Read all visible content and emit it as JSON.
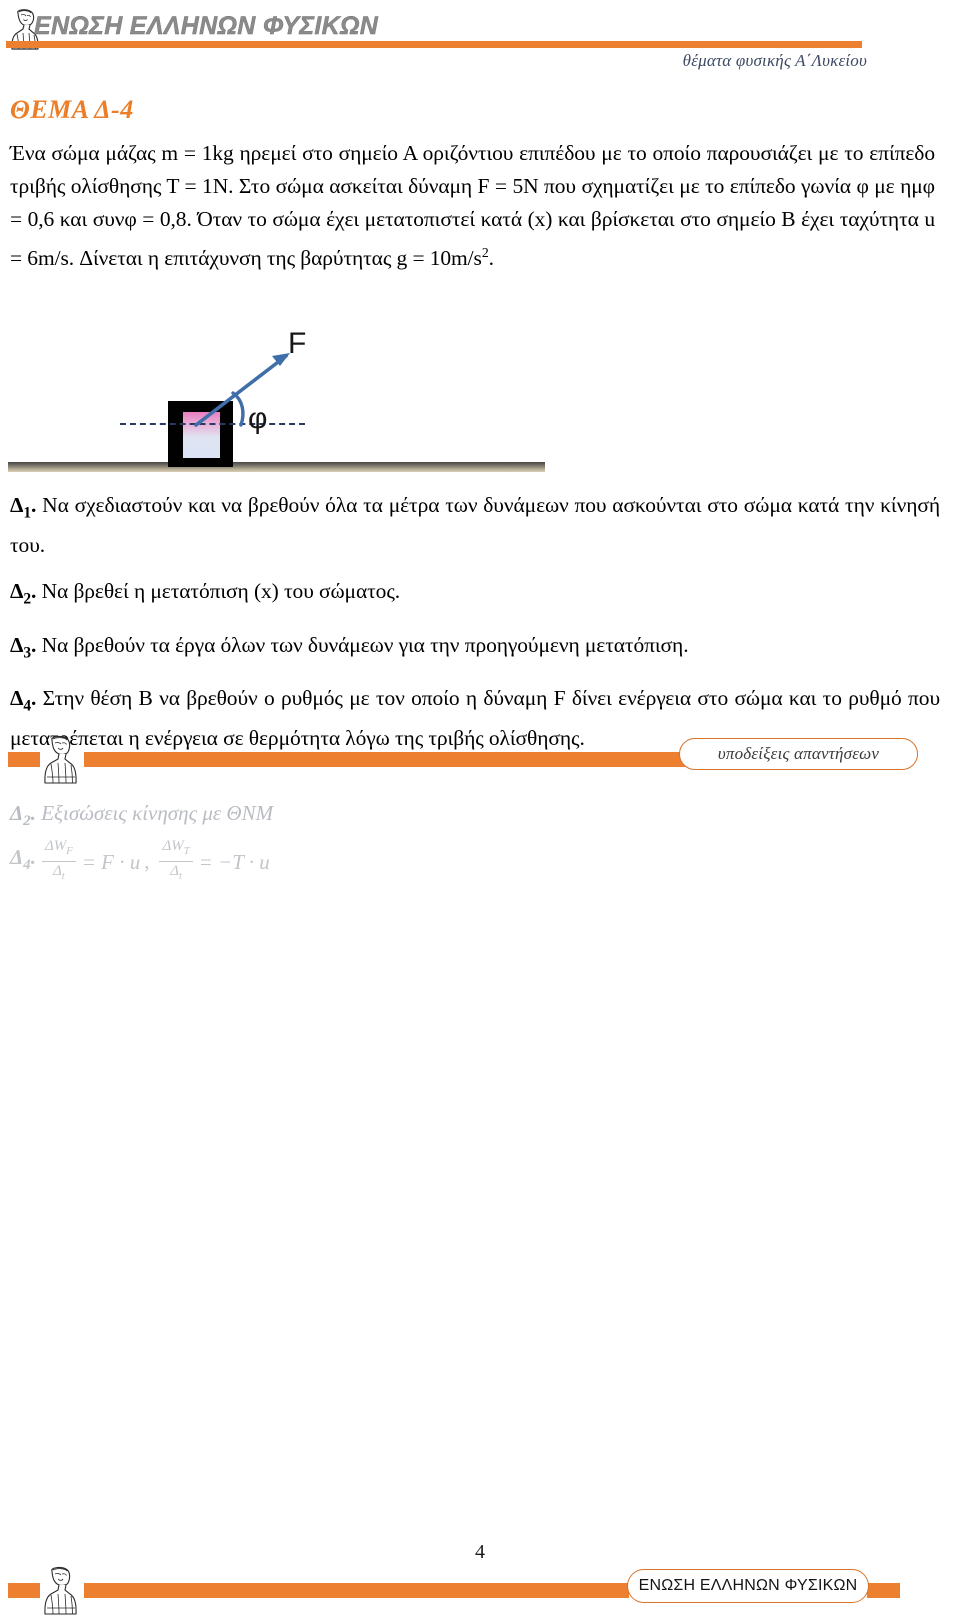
{
  "header": {
    "logo_text": "ΕΝΩΣΗ ΕΛΛΗΝΩΝ ΦΥΣΙΚΩΝ",
    "subtitle": "θέματα φυσικής Α΄Λυκείου",
    "rule_color": "#ed8030"
  },
  "title": "ΘΕΜΑ Δ-4",
  "title_color": "#ed7d26",
  "intro": {
    "part1": "Ένα σώμα μάζας m = 1kg ηρεμεί στο σημείο Α οριζόντιου επιπέδου με το οποίο παρουσιάζει με το επίπεδο τριβής ολίσθησης Τ = 1Ν. Στο σώμα ασκείται δύναμη F = 5Ν που σχηματίζει με το επίπεδο γωνία φ με ημφ = 0,6 και συνφ = 0,8. Όταν το σώμα έχει μετατοπιστεί κατά (x) και βρίσκεται στο σημείο Β έχει ταχύτητα u = 6m/s. Δίνεται η επιτάχυνση της βαρύτητας g = 10m/s",
    "exponent": "2",
    "part2": "."
  },
  "diagram": {
    "force_label": "F",
    "angle_label": "φ",
    "arrow_color": "#3f6ea8",
    "box_color": "#010101",
    "dashed_color": "#2b3a60",
    "ground_colors": [
      "#4a4742",
      "#d8cfb6"
    ]
  },
  "questions": [
    {
      "label": "Δ",
      "index": "1",
      "text": "Να σχεδιαστούν και να βρεθούν όλα τα μέτρα των δυνάμεων που ασκούνται στο σώμα κατά την κίνησή του."
    },
    {
      "label": "Δ",
      "index": "2",
      "text": "Να βρεθεί η μετατόπιση (x) του σώματος."
    },
    {
      "label": "Δ",
      "index": "3",
      "text": "Να βρεθούν τα έργα όλων των δυνάμεων για την προηγούμενη μετατόπιση."
    },
    {
      "label": "Δ",
      "index": "4",
      "text": "Στην θέση Β να βρεθούν ο ρυθμός με τον οποίο η δύναμη F δίνει ενέργεια στο σώμα και το ρυθμό που μετατρέπεται η ενέργεια σε θερμότητα λόγω της τριβής ολίσθησης."
    }
  ],
  "hints": {
    "pill_label": "υποδείξεις απαντήσεων",
    "answer_text_line": {
      "label": "Δ",
      "index": "2",
      "text": "Εξισώσεις κίνησης με ΘΝΜ"
    },
    "answer_formula_line": {
      "label": "Δ",
      "index": "4",
      "frac1_num": "ΔW",
      "frac1_num_sub": "F",
      "frac1_den": "Δ",
      "frac1_den_sub": "t",
      "eq1": "= F · u",
      "separator": ",",
      "frac2_num": "ΔW",
      "frac2_num_sub": "T",
      "frac2_den": "Δ",
      "frac2_den_sub": "t",
      "eq2": "= −T · u"
    }
  },
  "page_number": "4",
  "footer": {
    "pill_label": "ΕΝΩΣΗ ΕΛΛΗΝΩΝ ΦΥΣΙΚΩΝ",
    "bar_color": "#ed8030"
  }
}
